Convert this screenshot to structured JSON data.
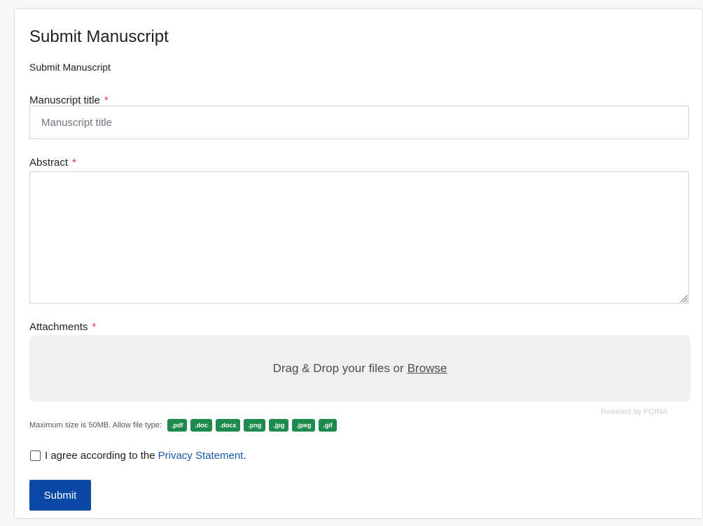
{
  "form": {
    "title": "Submit Manuscript",
    "subtitle": "Submit Manuscript",
    "required_marker": "*",
    "manuscript_title": {
      "label": "Manuscript title",
      "placeholder": "Manuscript title",
      "value": ""
    },
    "abstract": {
      "label": "Abstract",
      "value": ""
    },
    "attachments": {
      "label": "Attachments",
      "drop_text": "Drag & Drop your files or",
      "browse_label": "Browse",
      "powered_by": "Powered by PQINA",
      "max_size_text": "Maximum size is 50MB. Allow file type:",
      "file_types": [
        ".pdf",
        ".doc",
        ".docx",
        ".png",
        ".jpg",
        ".jpeg",
        ".gif"
      ]
    },
    "agree": {
      "checked": false,
      "text": "I agree according to the",
      "link_label": "Privacy Statement",
      "suffix": "."
    },
    "submit_label": "Submit"
  },
  "colors": {
    "primary": "#0a48a8",
    "badge": "#1e8a4c",
    "required": "#dc3545",
    "link": "#1a5aa8",
    "dropzone_bg": "#f0efee"
  }
}
